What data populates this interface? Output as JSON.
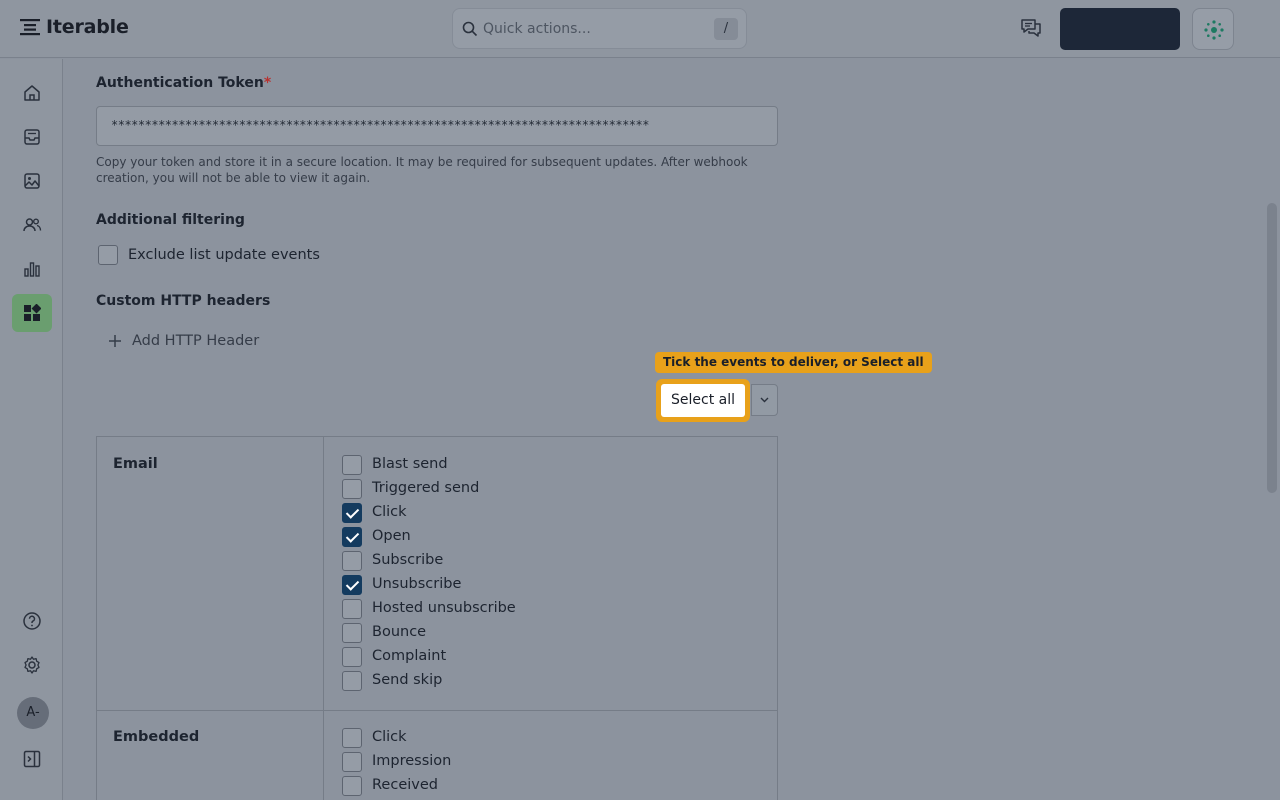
{
  "app": {
    "brand": "Iterable"
  },
  "search": {
    "placeholder": "Quick actions...",
    "shortcut": "/"
  },
  "form": {
    "auth_label": "Authentication Token",
    "auth_required_mark": "*",
    "auth_token": "********************************************************************************",
    "auth_helper": "Copy your token and store it in a secure location. It may be required for subsequent updates. After webhook creation, you will not be able to view it again.",
    "filtering_label": "Additional filtering",
    "exclude_label": "Exclude list update events",
    "exclude_checked": false,
    "headers_label": "Custom HTTP headers",
    "add_header": "Add HTTP Header"
  },
  "tooltip": "Tick the events to deliver, or Select all",
  "select_all": "Select all",
  "sections": {
    "email": {
      "label": "Email",
      "events": [
        {
          "label": "Blast send",
          "checked": false
        },
        {
          "label": "Triggered send",
          "checked": false
        },
        {
          "label": "Click",
          "checked": true
        },
        {
          "label": "Open",
          "checked": true
        },
        {
          "label": "Subscribe",
          "checked": false
        },
        {
          "label": "Unsubscribe",
          "checked": true
        },
        {
          "label": "Hosted unsubscribe",
          "checked": false
        },
        {
          "label": "Bounce",
          "checked": false
        },
        {
          "label": "Complaint",
          "checked": false
        },
        {
          "label": "Send skip",
          "checked": false
        }
      ]
    },
    "embedded": {
      "label": "Embedded",
      "events": [
        {
          "label": "Click",
          "checked": false
        },
        {
          "label": "Impression",
          "checked": false
        },
        {
          "label": "Received",
          "checked": false
        }
      ]
    }
  },
  "user": {
    "avatar_initials": "A-"
  },
  "colors": {
    "accent": "#e8a11a",
    "checkbox_checked": "#143b5f",
    "sidebar_active": "#6a9e6f",
    "primary_dark": "#1d2738"
  },
  "icons": [
    "home-icon",
    "inbox-icon",
    "image-icon",
    "users-icon",
    "analytics-icon",
    "integrations-icon",
    "help-icon",
    "settings-icon",
    "collapse-sidebar-icon",
    "chat-icon",
    "sparkle-icon",
    "search-icon",
    "plus-icon",
    "chevron-down-icon"
  ]
}
